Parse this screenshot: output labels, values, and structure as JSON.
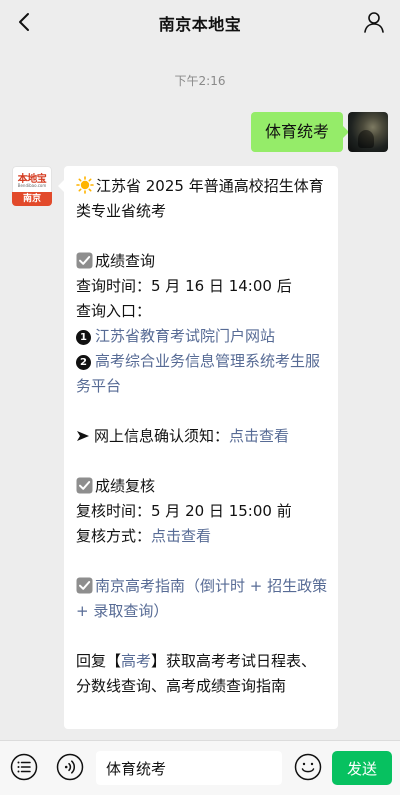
{
  "header": {
    "title": "南京本地宝"
  },
  "chat": {
    "timestamp": "下午2:16",
    "outgoing_text": "体育统考",
    "bot_logo": {
      "top": "本地宝",
      "url": "Bendibao.com",
      "city": "南京"
    },
    "incoming": {
      "intro": "江苏省 2025 年普通高校招生体育类专业省统考",
      "score_query_title": "成绩查询",
      "score_query_time": "查询时间：5 月 16 日 14:00 后",
      "score_query_entry_label": "查询入口：",
      "entry_1_number": "1",
      "entry_1_link": "江苏省教育考试院门户网站",
      "entry_2_number": "2",
      "entry_2_link": "高考综合业务信息管理系统考生服务平台",
      "notice_prefix": "网上信息确认须知：",
      "notice_link": "点击查看",
      "review_title": "成绩复核",
      "review_time": "复核时间：5 月 20 日 15:00 前",
      "review_method_prefix": "复核方式：",
      "review_method_link": "点击查看",
      "guide_link": "南京高考指南（倒计时 + 招生政策 + 录取查询）",
      "reply_prefix": "回复【",
      "reply_keyword": "高考",
      "reply_suffix": "】获取高考考试日程表、分数线查询、高考成绩查询指南"
    }
  },
  "input_bar": {
    "input_value": "体育统考",
    "send_label": "发送"
  },
  "colors": {
    "outgoing_bubble": "#95ec69",
    "link": "#576b95",
    "send_button": "#07c160",
    "background": "#ededed"
  },
  "icons": {
    "back": "chevron-left-icon",
    "profile": "person-icon",
    "sun": "sun-icon",
    "check": "check-box-icon",
    "arrow": "arrowhead-icon",
    "menu": "menu-list-icon",
    "voice": "voice-icon",
    "emoji": "emoji-icon"
  }
}
